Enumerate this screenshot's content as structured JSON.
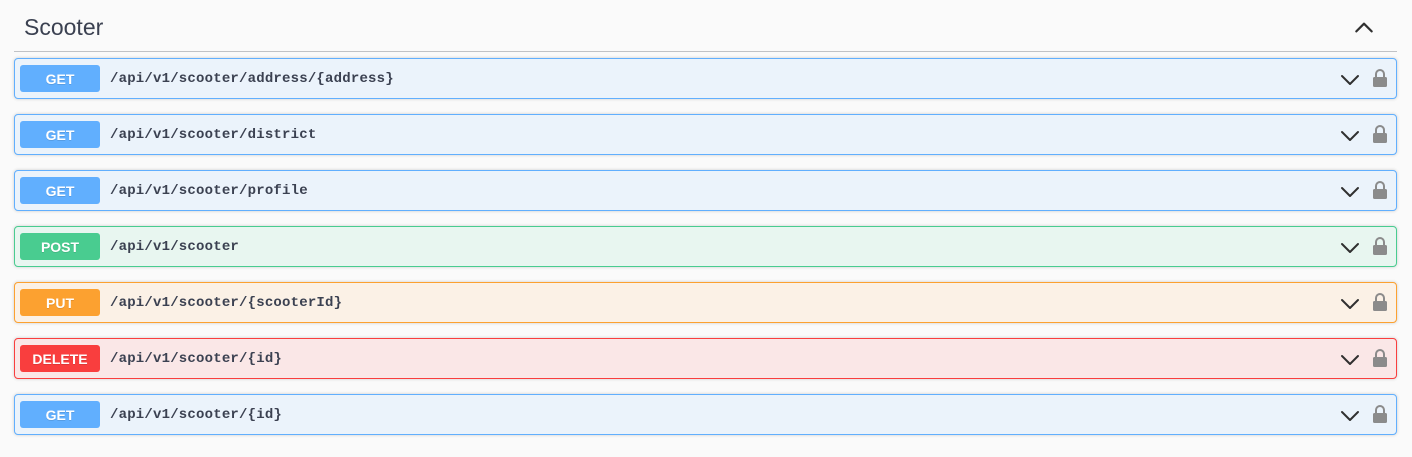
{
  "tag": {
    "title": "Scooter",
    "toggle_icon": "chevron-up-icon"
  },
  "colors": {
    "GET": {
      "bg": "#ebf3fb",
      "border": "#61affe",
      "badge": "#61affe"
    },
    "POST": {
      "bg": "#e8f6f0",
      "border": "#49cc90",
      "badge": "#49cc90"
    },
    "PUT": {
      "bg": "#fbf1e6",
      "border": "#fca130",
      "badge": "#fca130"
    },
    "DELETE": {
      "bg": "#fae7e7",
      "border": "#f93e3e",
      "badge": "#f93e3e"
    }
  },
  "operations": [
    {
      "method": "GET",
      "path": "/api/v1/scooter/address/{address}"
    },
    {
      "method": "GET",
      "path": "/api/v1/scooter/district"
    },
    {
      "method": "GET",
      "path": "/api/v1/scooter/profile"
    },
    {
      "method": "POST",
      "path": "/api/v1/scooter"
    },
    {
      "method": "PUT",
      "path": "/api/v1/scooter/{scooterId}"
    },
    {
      "method": "DELETE",
      "path": "/api/v1/scooter/{id}"
    },
    {
      "method": "GET",
      "path": "/api/v1/scooter/{id}"
    }
  ],
  "icons": {
    "expand": "chevron-down-icon",
    "auth": "lock-icon"
  }
}
